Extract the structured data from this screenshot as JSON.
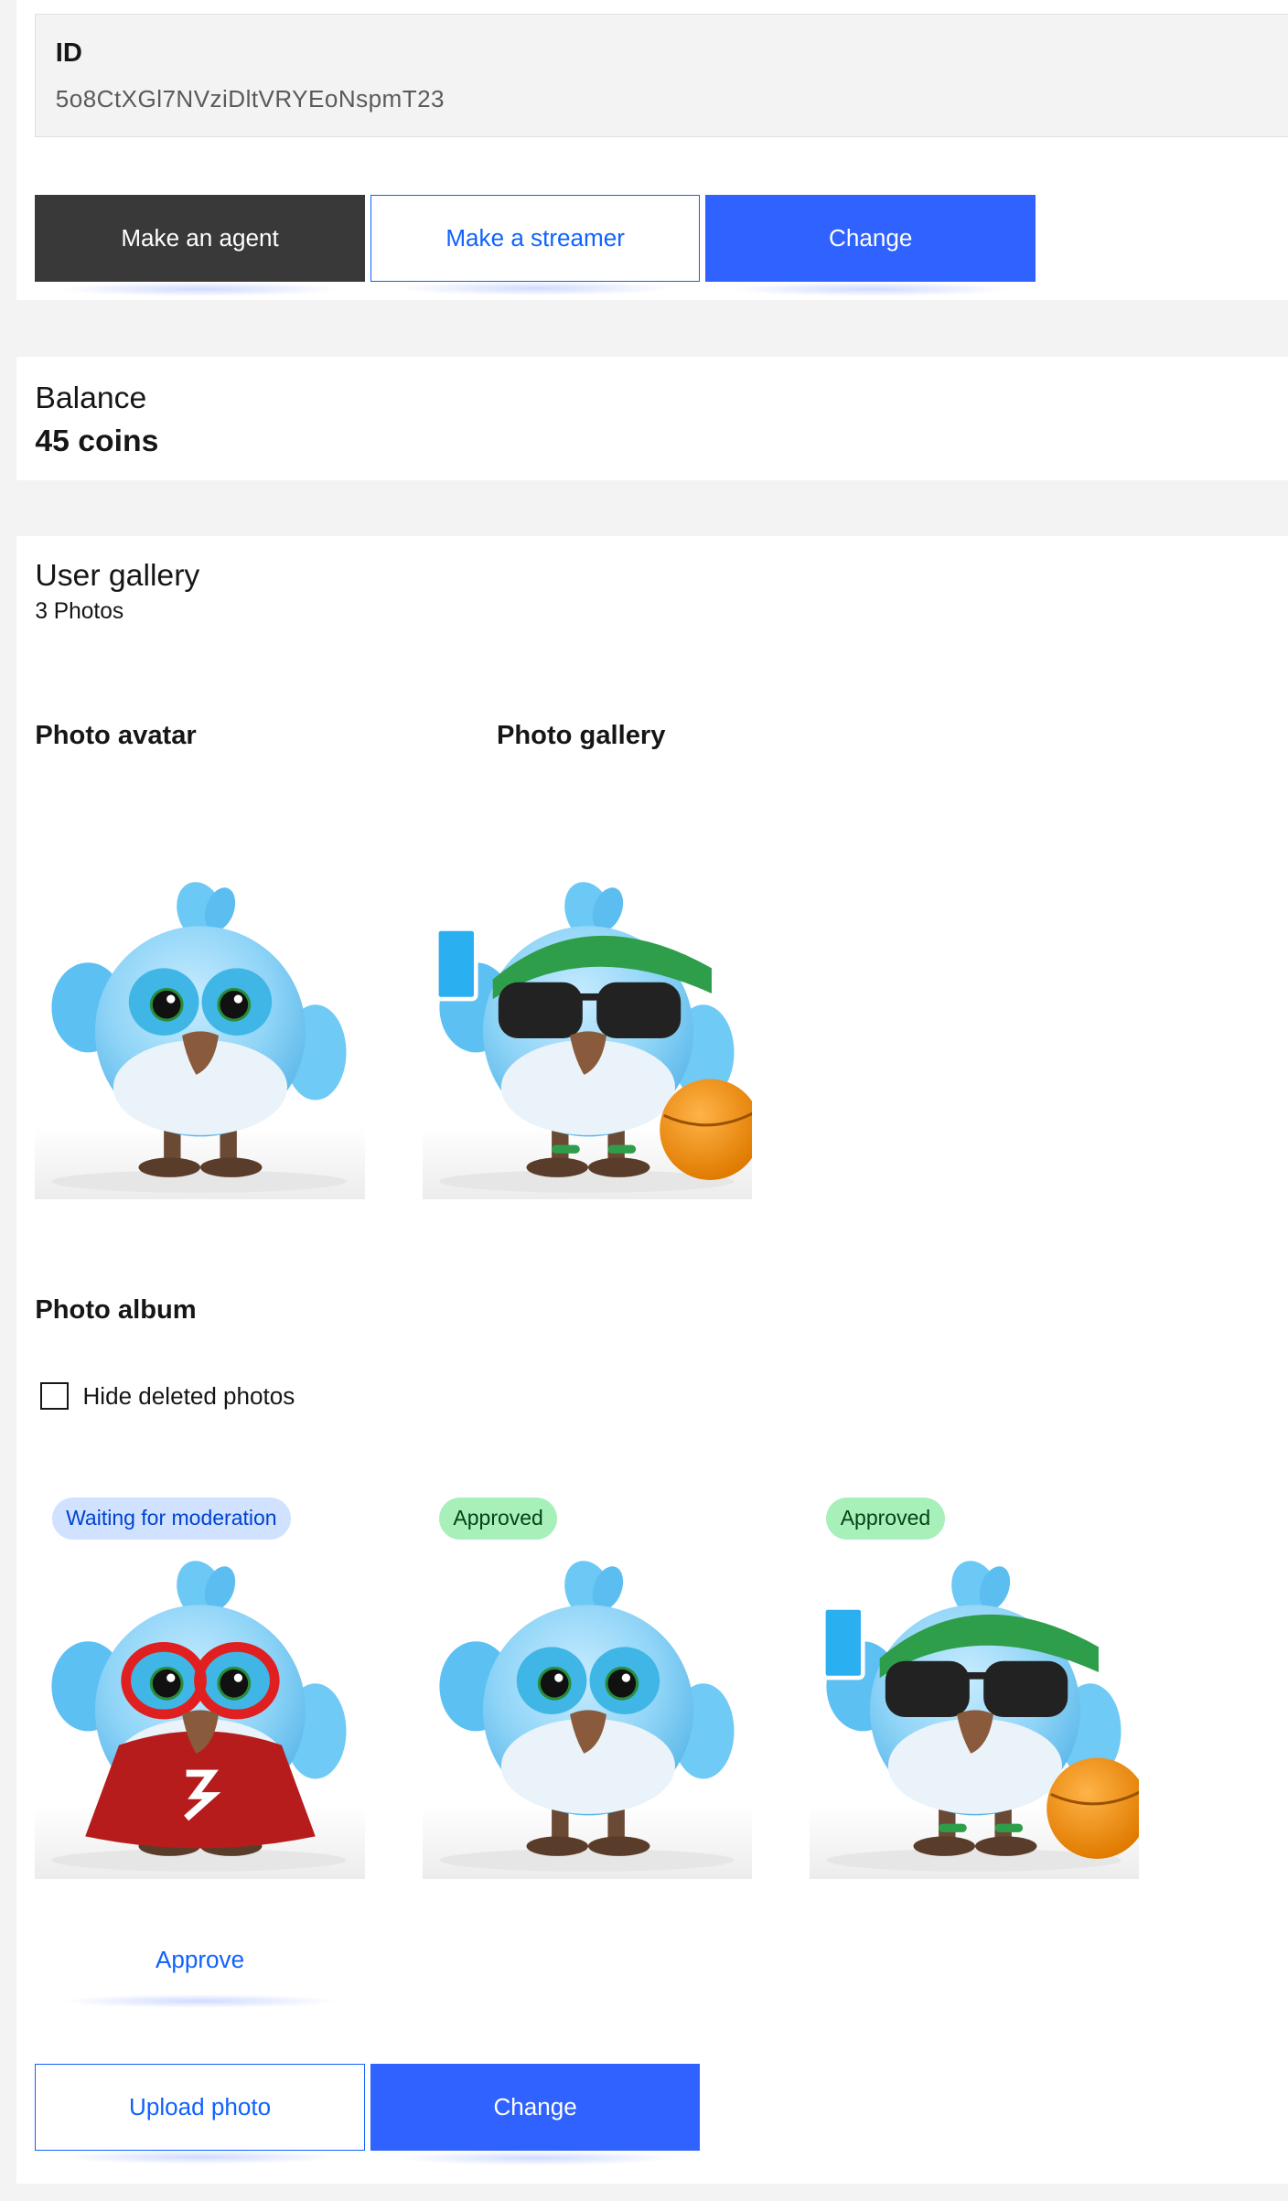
{
  "id_section": {
    "label": "ID",
    "value": "5o8CtXGl7NVziDltVRYEoNspmT23"
  },
  "actions": {
    "make_agent": "Make an agent",
    "make_streamer": "Make a streamer",
    "change": "Change"
  },
  "balance": {
    "title": "Balance",
    "value": "45 coins"
  },
  "gallery": {
    "title": "User gallery",
    "count": "3 Photos",
    "avatar_title": "Photo avatar",
    "gallery_title": "Photo gallery",
    "album_title": "Photo album",
    "hide_deleted_label": "Hide deleted photos",
    "album": [
      {
        "status": "Waiting for moderation",
        "variant": "superhero"
      },
      {
        "status": "Approved",
        "variant": "plain"
      },
      {
        "status": "Approved",
        "variant": "sporty"
      }
    ],
    "approve_label": "Approve",
    "upload_label": "Upload photo",
    "change_label": "Change"
  },
  "colors": {
    "primary": "#2f62ff",
    "dark_button": "#393939",
    "pending_badge": "#d0e2ff",
    "approved_badge": "#a7f0ba"
  }
}
